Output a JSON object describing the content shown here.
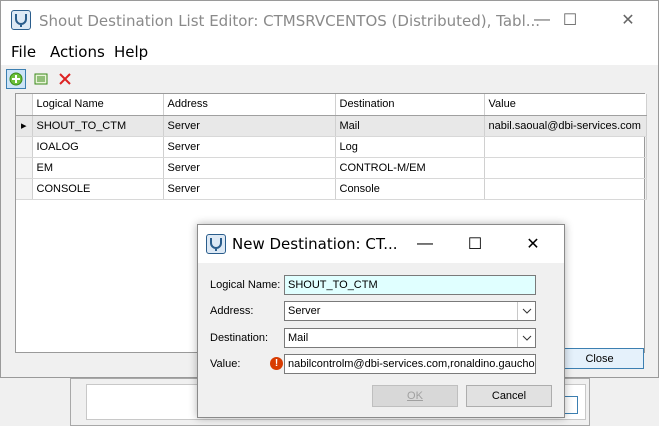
{
  "main_window": {
    "title": "Shout Destination List Editor: CTMSRVCENTOS (Distributed), Tabl...",
    "minimize_glyph": "—",
    "maximize_glyph": "☐",
    "close_glyph": "✕",
    "menu": [
      "File",
      "Actions",
      "Help"
    ],
    "toolbar": {
      "add_icon": "add-icon",
      "edit_icon": "edit-icon",
      "delete_icon": "delete-icon"
    },
    "grid": {
      "columns": [
        "Logical Name",
        "Address",
        "Destination",
        "Value"
      ],
      "rows": [
        {
          "marker": "▸",
          "logical_name": "SHOUT_TO_CTM",
          "address": "Server",
          "destination": "Mail",
          "value": "nabil.saoual@dbi-services.com"
        },
        {
          "marker": "",
          "logical_name": "IOALOG",
          "address": "Server",
          "destination": "Log",
          "value": ""
        },
        {
          "marker": "",
          "logical_name": "EM",
          "address": "Server",
          "destination": "CONTROL-M/EM",
          "value": ""
        },
        {
          "marker": "",
          "logical_name": "CONSOLE",
          "address": "Server",
          "destination": "Console",
          "value": ""
        }
      ]
    },
    "close_button": "Close"
  },
  "dialog": {
    "title": "New Destination: CT...",
    "minimize_glyph": "—",
    "maximize_glyph": "☐",
    "close_glyph": "✕",
    "labels": {
      "logical_name": "Logical Name:",
      "address": "Address:",
      "destination": "Destination:",
      "value": "Value:"
    },
    "values": {
      "logical_name": "SHOUT_TO_CTM",
      "address": "Server",
      "destination": "Mail",
      "value": "nabilcontrolm@dbi-services.com,ronaldino.gaucho@"
    },
    "error_glyph": "!",
    "ok_button": "OK",
    "cancel_button": "Cancel"
  },
  "colors": {
    "accent": "#3c7fb1",
    "selected_field": "#e0ffff",
    "error": "#d83b01"
  }
}
